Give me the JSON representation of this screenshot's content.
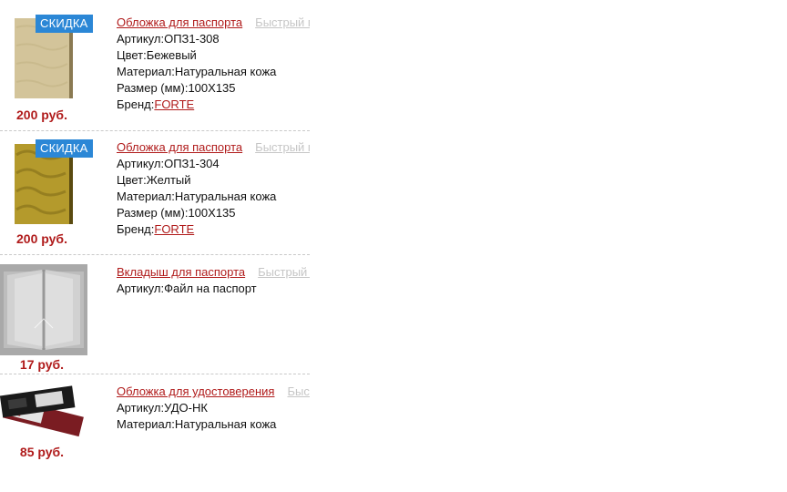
{
  "products": [
    {
      "badge": "СКИДКА",
      "price": "200 руб.",
      "title": "Обложка для паспорта",
      "quick_view": "Быстрый п",
      "attrs": [
        {
          "label": "Артикул:",
          "value": "ОПЗ1-308"
        },
        {
          "label": "Цвет:",
          "value": "Бежевый"
        },
        {
          "label": "Материал:",
          "value": "Натуральная кожа"
        },
        {
          "label": "Размер (мм):",
          "value": "100X135"
        },
        {
          "label": "Бренд:",
          "value": "FORTE"
        }
      ],
      "image_colors": {
        "main": "#d3c49a",
        "dark": "#b9a877",
        "spine": "#8a7a52"
      }
    },
    {
      "badge": "СКИДКА",
      "price": "200 руб.",
      "title": "Обложка для паспорта",
      "quick_view": "Быстрый п",
      "attrs": [
        {
          "label": "Артикул:",
          "value": "ОПЗ1-304"
        },
        {
          "label": "Цвет:",
          "value": "Желтый"
        },
        {
          "label": "Материал:",
          "value": "Натуральная кожа"
        },
        {
          "label": "Размер (мм):",
          "value": "100X135"
        },
        {
          "label": "Бренд:",
          "value": "FORTE"
        }
      ],
      "image_colors": {
        "main": "#b49a2c",
        "dark": "#7e6a18",
        "spine": "#5a4a10"
      }
    },
    {
      "price": "17 руб.",
      "title": "Вкладыш для паспорта",
      "quick_view": "Быстрый п",
      "attrs": [
        {
          "label": "Артикул:",
          "value": "Файл на паспорт"
        }
      ],
      "image_colors": {
        "bg": "#a9a9a9",
        "sheet": "#d6d6d6"
      }
    },
    {
      "price": "85 руб.",
      "title": "Обложка для удостоверения",
      "quick_view": "Быст",
      "attrs": [
        {
          "label": "Артикул:",
          "value": "УДО-НК"
        },
        {
          "label": "Материал:",
          "value": "Натуральная кожа"
        }
      ],
      "image_colors": {
        "black": "#1a1a1a",
        "red": "#7a1c22"
      }
    }
  ]
}
